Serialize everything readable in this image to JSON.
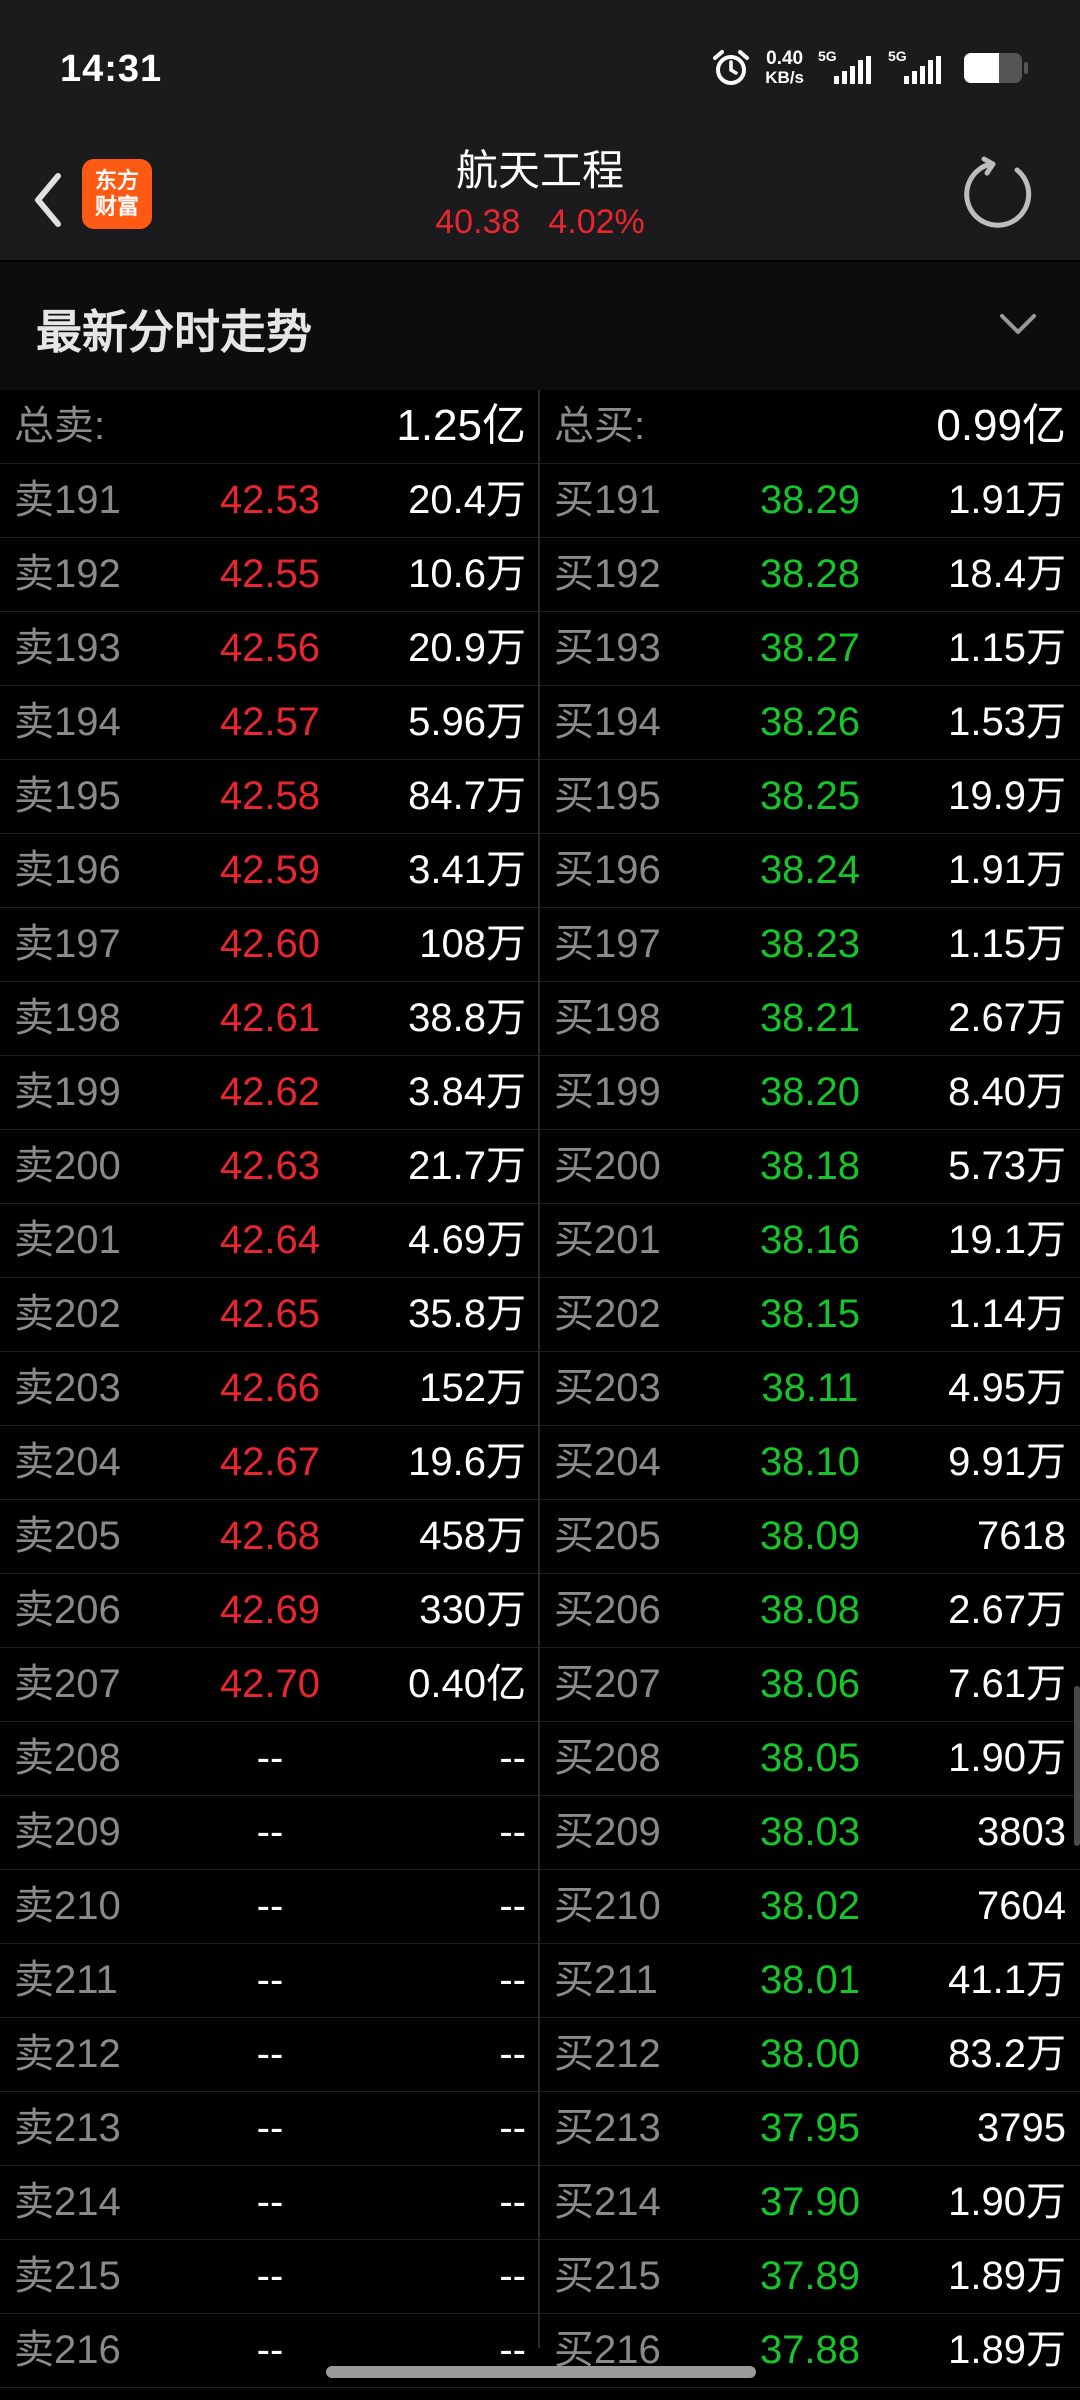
{
  "status_bar": {
    "time": "14:31",
    "net_speed_value": "0.40",
    "net_speed_unit": "KB/s",
    "signal_1_label": "5G",
    "signal_2_label": "5G",
    "battery_level": 0.6
  },
  "header": {
    "logo_line1": "东方",
    "logo_line2": "财富",
    "stock_name": "航天工程",
    "price": "40.38",
    "change_pct": "4.02%"
  },
  "section": {
    "title": "最新分时走势"
  },
  "totals": {
    "sell_label": "总卖:",
    "sell_value": "1.25亿",
    "buy_label": "总买:",
    "buy_value": "0.99亿"
  },
  "rows": [
    {
      "sell_label": "卖191",
      "sell_price": "42.53",
      "sell_vol": "20.4万",
      "buy_label": "买191",
      "buy_price": "38.29",
      "buy_vol": "1.91万"
    },
    {
      "sell_label": "卖192",
      "sell_price": "42.55",
      "sell_vol": "10.6万",
      "buy_label": "买192",
      "buy_price": "38.28",
      "buy_vol": "18.4万"
    },
    {
      "sell_label": "卖193",
      "sell_price": "42.56",
      "sell_vol": "20.9万",
      "buy_label": "买193",
      "buy_price": "38.27",
      "buy_vol": "1.15万"
    },
    {
      "sell_label": "卖194",
      "sell_price": "42.57",
      "sell_vol": "5.96万",
      "buy_label": "买194",
      "buy_price": "38.26",
      "buy_vol": "1.53万"
    },
    {
      "sell_label": "卖195",
      "sell_price": "42.58",
      "sell_vol": "84.7万",
      "buy_label": "买195",
      "buy_price": "38.25",
      "buy_vol": "19.9万"
    },
    {
      "sell_label": "卖196",
      "sell_price": "42.59",
      "sell_vol": "3.41万",
      "buy_label": "买196",
      "buy_price": "38.24",
      "buy_vol": "1.91万"
    },
    {
      "sell_label": "卖197",
      "sell_price": "42.60",
      "sell_vol": "108万",
      "buy_label": "买197",
      "buy_price": "38.23",
      "buy_vol": "1.15万"
    },
    {
      "sell_label": "卖198",
      "sell_price": "42.61",
      "sell_vol": "38.8万",
      "buy_label": "买198",
      "buy_price": "38.21",
      "buy_vol": "2.67万"
    },
    {
      "sell_label": "卖199",
      "sell_price": "42.62",
      "sell_vol": "3.84万",
      "buy_label": "买199",
      "buy_price": "38.20",
      "buy_vol": "8.40万"
    },
    {
      "sell_label": "卖200",
      "sell_price": "42.63",
      "sell_vol": "21.7万",
      "buy_label": "买200",
      "buy_price": "38.18",
      "buy_vol": "5.73万"
    },
    {
      "sell_label": "卖201",
      "sell_price": "42.64",
      "sell_vol": "4.69万",
      "buy_label": "买201",
      "buy_price": "38.16",
      "buy_vol": "19.1万"
    },
    {
      "sell_label": "卖202",
      "sell_price": "42.65",
      "sell_vol": "35.8万",
      "buy_label": "买202",
      "buy_price": "38.15",
      "buy_vol": "1.14万"
    },
    {
      "sell_label": "卖203",
      "sell_price": "42.66",
      "sell_vol": "152万",
      "buy_label": "买203",
      "buy_price": "38.11",
      "buy_vol": "4.95万"
    },
    {
      "sell_label": "卖204",
      "sell_price": "42.67",
      "sell_vol": "19.6万",
      "buy_label": "买204",
      "buy_price": "38.10",
      "buy_vol": "9.91万"
    },
    {
      "sell_label": "卖205",
      "sell_price": "42.68",
      "sell_vol": "458万",
      "buy_label": "买205",
      "buy_price": "38.09",
      "buy_vol": "7618"
    },
    {
      "sell_label": "卖206",
      "sell_price": "42.69",
      "sell_vol": "330万",
      "buy_label": "买206",
      "buy_price": "38.08",
      "buy_vol": "2.67万"
    },
    {
      "sell_label": "卖207",
      "sell_price": "42.70",
      "sell_vol": "0.40亿",
      "buy_label": "买207",
      "buy_price": "38.06",
      "buy_vol": "7.61万"
    },
    {
      "sell_label": "卖208",
      "sell_price": "--",
      "sell_vol": "--",
      "buy_label": "买208",
      "buy_price": "38.05",
      "buy_vol": "1.90万"
    },
    {
      "sell_label": "卖209",
      "sell_price": "--",
      "sell_vol": "--",
      "buy_label": "买209",
      "buy_price": "38.03",
      "buy_vol": "3803"
    },
    {
      "sell_label": "卖210",
      "sell_price": "--",
      "sell_vol": "--",
      "buy_label": "买210",
      "buy_price": "38.02",
      "buy_vol": "7604"
    },
    {
      "sell_label": "卖211",
      "sell_price": "--",
      "sell_vol": "--",
      "buy_label": "买211",
      "buy_price": "38.01",
      "buy_vol": "41.1万"
    },
    {
      "sell_label": "卖212",
      "sell_price": "--",
      "sell_vol": "--",
      "buy_label": "买212",
      "buy_price": "38.00",
      "buy_vol": "83.2万"
    },
    {
      "sell_label": "卖213",
      "sell_price": "--",
      "sell_vol": "--",
      "buy_label": "买213",
      "buy_price": "37.95",
      "buy_vol": "3795"
    },
    {
      "sell_label": "卖214",
      "sell_price": "--",
      "sell_vol": "--",
      "buy_label": "买214",
      "buy_price": "37.90",
      "buy_vol": "1.90万"
    },
    {
      "sell_label": "卖215",
      "sell_price": "--",
      "sell_vol": "--",
      "buy_label": "买215",
      "buy_price": "37.89",
      "buy_vol": "1.89万"
    },
    {
      "sell_label": "卖216",
      "sell_price": "--",
      "sell_vol": "--",
      "buy_label": "买216",
      "buy_price": "37.88",
      "buy_vol": "1.89万"
    }
  ],
  "colors": {
    "sell_price": "#e8262f",
    "buy_price": "#16c52a",
    "logo_bg": "#ff5a14"
  },
  "icons": {
    "back": "back-arrow-icon",
    "alarm": "alarm-clock-icon",
    "refresh": "refresh-icon",
    "chevron": "chevron-down-icon"
  }
}
